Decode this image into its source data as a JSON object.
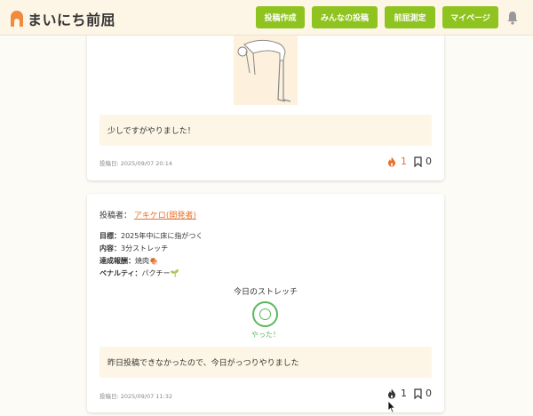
{
  "header": {
    "app_title": "まいにち前屈",
    "nav": [
      {
        "label": "投稿作成"
      },
      {
        "label": "みんなの投稿"
      },
      {
        "label": "前屈測定"
      },
      {
        "label": "マイページ"
      }
    ],
    "accent_color": "#8fc31f"
  },
  "posts": [
    {
      "comment": "少しですがやりました！",
      "date": "投稿日: 2025/09/07 20:14",
      "likes": "1",
      "bookmarks": "0",
      "liked": true
    },
    {
      "author_label": "投稿者：",
      "author_name": "アキケロ(開発者)",
      "goal_label": "目標：",
      "goal": "2025年中に床に指がつく",
      "content_label": "内容：",
      "content": "3分ストレッチ",
      "reward_label": "達成報酬：",
      "reward": "焼肉🍖",
      "penalty_label": "ペナルティ：",
      "penalty": "パクチー🌱",
      "stretch_title": "今日のストレッチ",
      "done_label": "やった！",
      "comment": "昨日投稿できなかったので、今日がっつりやりました",
      "date": "投稿日: 2025/09/07 11:32",
      "likes": "1",
      "bookmarks": "0",
      "liked": false
    }
  ]
}
